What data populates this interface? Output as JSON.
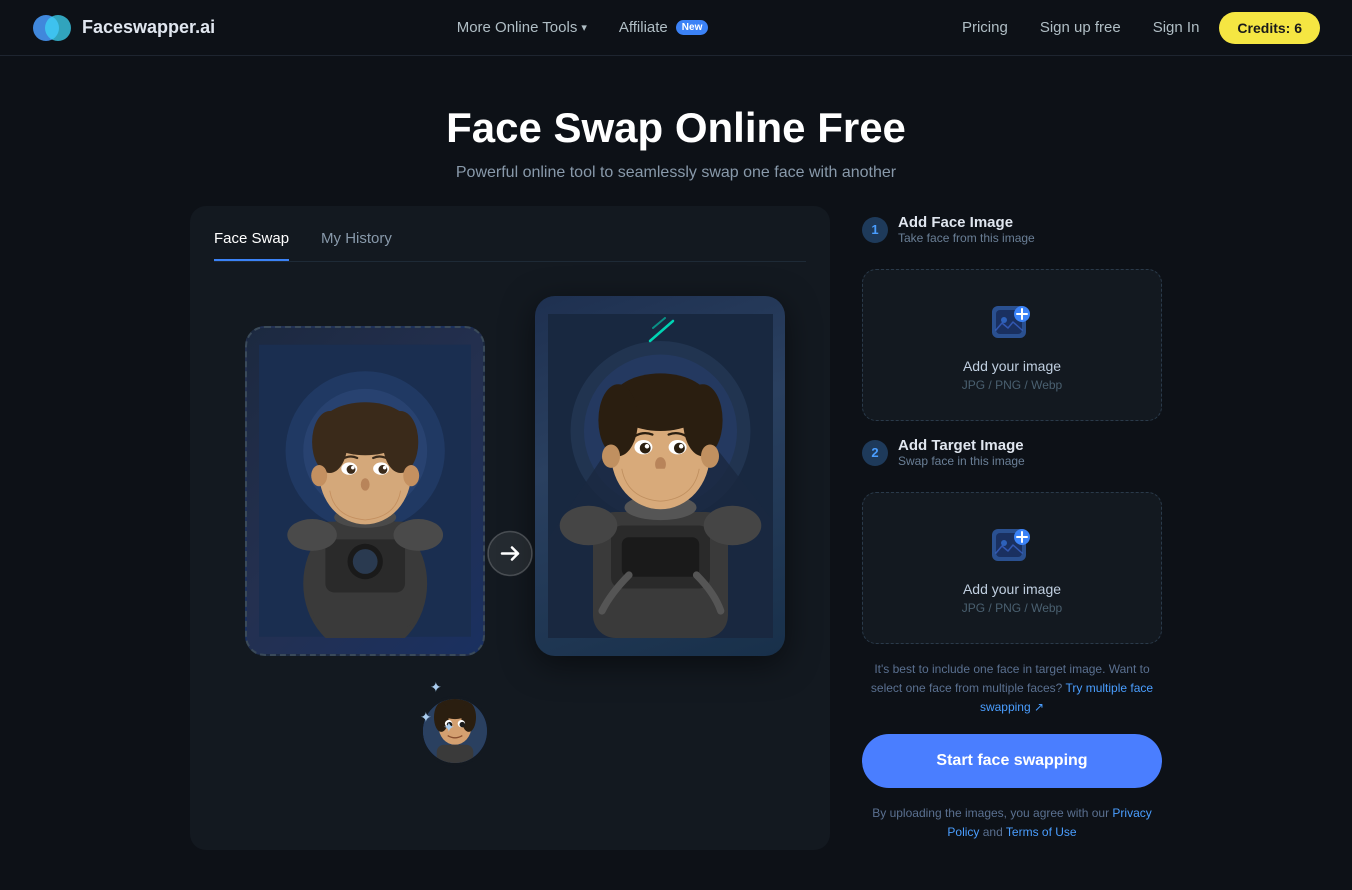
{
  "nav": {
    "brand": "Faceswapper.ai",
    "more_tools_label": "More Online Tools",
    "affiliate_label": "Affiliate",
    "affiliate_badge": "New",
    "pricing_label": "Pricing",
    "signup_label": "Sign up free",
    "signin_label": "Sign In",
    "credits_label": "Credits: 6"
  },
  "hero": {
    "title": "Face Swap Online Free",
    "subtitle": "Powerful online tool to seamlessly swap one face with another"
  },
  "tabs": [
    {
      "label": "Face Swap",
      "active": true
    },
    {
      "label": "My History",
      "active": false
    }
  ],
  "step1": {
    "number": "1",
    "title": "Add Face Image",
    "subtitle": "Take face from this image",
    "upload_text": "Add your image",
    "upload_hint": "JPG / PNG / Webp"
  },
  "step2": {
    "number": "2",
    "title": "Add Target Image",
    "subtitle": "Swap face in this image",
    "upload_text": "Add your image",
    "upload_hint": "JPG / PNG / Webp"
  },
  "hint": "It's best to include one face in target image. Want to select one face from multiple faces?",
  "hint_link": "Try multiple face swapping ↗",
  "start_button": "Start face swapping",
  "terms_text": "By uploading the images, you agree with our",
  "terms_privacy": "Privacy Policy",
  "terms_and": "and",
  "terms_tos": "Terms of Use",
  "colors": {
    "accent": "#4a7eff",
    "brand_yellow": "#f5e642",
    "bg_dark": "#0d1117",
    "bg_panel": "#131920",
    "border": "#1e2a36"
  }
}
